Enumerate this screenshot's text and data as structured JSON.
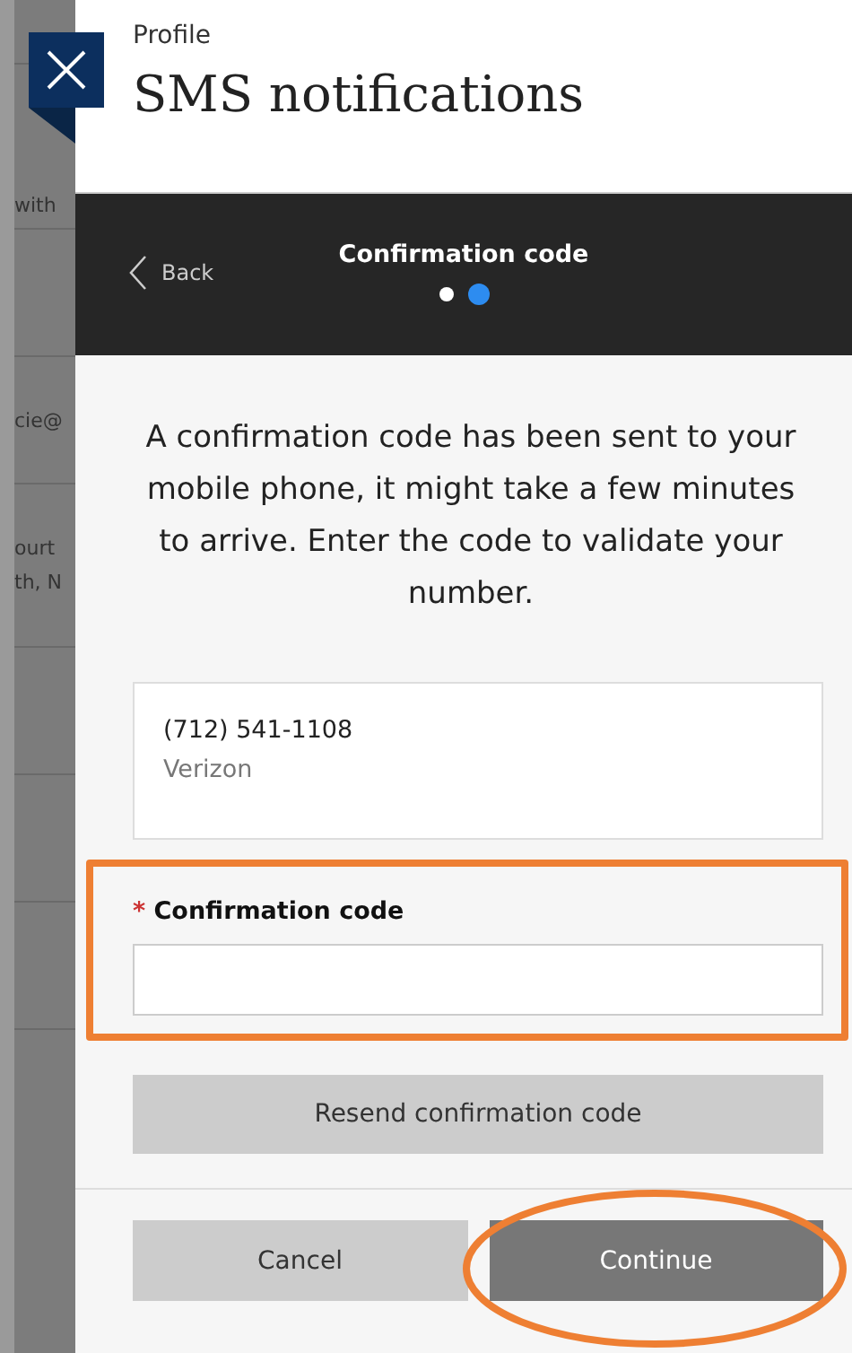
{
  "background_rows": [
    "with",
    "cie@",
    "ourt",
    "th, N"
  ],
  "panel": {
    "breadcrumb": "Profile",
    "title": "SMS notifications"
  },
  "step_bar": {
    "back": "Back",
    "title": "Confirmation code",
    "steps": [
      {
        "selected": false
      },
      {
        "selected": true
      }
    ]
  },
  "message": "A confirmation code has been sent to your mobile phone, it might take a few minutes to arrive. Enter the code to validate your number.",
  "phone": {
    "number": "(712) 541-1108",
    "carrier": "Verizon"
  },
  "code_field": {
    "required_mark": "*",
    "label": "Confirmation code",
    "highlighted": true
  },
  "resend_button": "Resend confirmation code",
  "buttons": [
    {
      "kind": "secondary",
      "label": "Cancel",
      "circled": false
    },
    {
      "kind": "primary",
      "label": "Continue",
      "circled": true
    }
  ]
}
